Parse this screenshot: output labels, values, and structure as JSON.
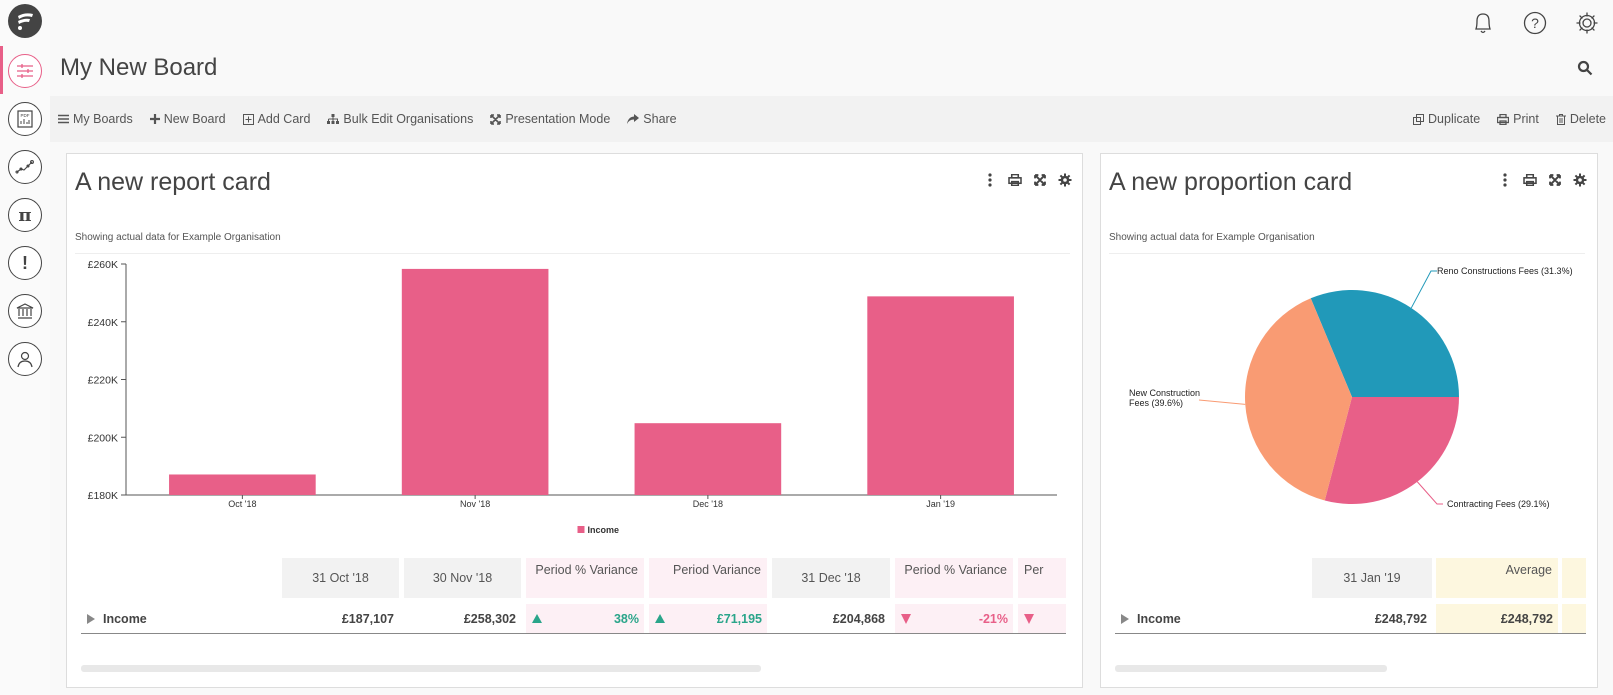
{
  "app": {
    "logo": "app-logo",
    "sidebar": [
      {
        "name": "boards",
        "icon": "sliders-icon",
        "active": true
      },
      {
        "name": "reports",
        "icon": "pdf-report-icon"
      },
      {
        "name": "trends",
        "icon": "trend-line-icon"
      },
      {
        "name": "formulas",
        "icon": "pi-icon"
      },
      {
        "name": "alerts",
        "icon": "exclamation-icon"
      },
      {
        "name": "banking",
        "icon": "bank-icon"
      },
      {
        "name": "users",
        "icon": "user-icon"
      }
    ],
    "top_icons": [
      "bell-icon",
      "help-icon",
      "gear-icon"
    ]
  },
  "board": {
    "title": "My New Board",
    "toolbar_left": [
      {
        "label": "My Boards",
        "icon": "menu-icon"
      },
      {
        "label": "New Board",
        "icon": "plus-icon"
      },
      {
        "label": "Add Card",
        "icon": "add-card-icon"
      },
      {
        "label": "Bulk Edit Organisations",
        "icon": "org-chart-icon"
      },
      {
        "label": "Presentation Mode",
        "icon": "expand-icon"
      },
      {
        "label": "Share",
        "icon": "share-icon"
      }
    ],
    "toolbar_right": [
      {
        "label": "Duplicate",
        "icon": "duplicate-icon"
      },
      {
        "label": "Print",
        "icon": "print-icon"
      },
      {
        "label": "Delete",
        "icon": "trash-icon"
      }
    ]
  },
  "cards": [
    {
      "title": "A new report card",
      "subtitle": "Showing actual data for Example Organisation",
      "legend": "Income",
      "table": {
        "headers": [
          "31 Oct '18",
          "30 Nov '18",
          "Period % Variance",
          "Period Variance",
          "31 Dec '18",
          "Period % Variance",
          "Per"
        ],
        "row_label": "Income",
        "cells": [
          "£187,107",
          "£258,302",
          "38%",
          "£71,195",
          "£204,868",
          "-21%",
          ""
        ]
      }
    },
    {
      "title": "A new proportion card",
      "subtitle": "Showing actual data for Example Organisation",
      "table": {
        "headers": [
          "31 Jan '19",
          "Average"
        ],
        "row_label": "Income",
        "cells": [
          "£248,792",
          "£248,792"
        ]
      }
    }
  ],
  "colors": {
    "accent": "#e85f88",
    "teal": "#2199b9",
    "orange": "#f99b73",
    "up": "#2aa58a",
    "down": "#e85f88"
  },
  "chart_data": [
    {
      "type": "bar",
      "title": "",
      "categories": [
        "Oct '18",
        "Nov '18",
        "Dec '18",
        "Jan '19"
      ],
      "series": [
        {
          "name": "Income",
          "values": [
            187107,
            258302,
            204868,
            248792
          ]
        }
      ],
      "yticks": [
        "£180K",
        "£200K",
        "£220K",
        "£240K",
        "£260K"
      ],
      "ylim": [
        180000,
        260000
      ],
      "xlabel": "",
      "ylabel": "",
      "legend": "bottom-center",
      "color": "#e85f88"
    },
    {
      "type": "pie",
      "slices": [
        {
          "label": "Reno Constructions Fees (31.3%)",
          "value": 31.3,
          "color": "#2199b9"
        },
        {
          "label": "Contracting Fees (29.1%)",
          "value": 29.1,
          "color": "#e85f88"
        },
        {
          "label": "New Construction Fees (39.6%)",
          "value": 39.6,
          "color": "#f99b73"
        }
      ]
    }
  ]
}
